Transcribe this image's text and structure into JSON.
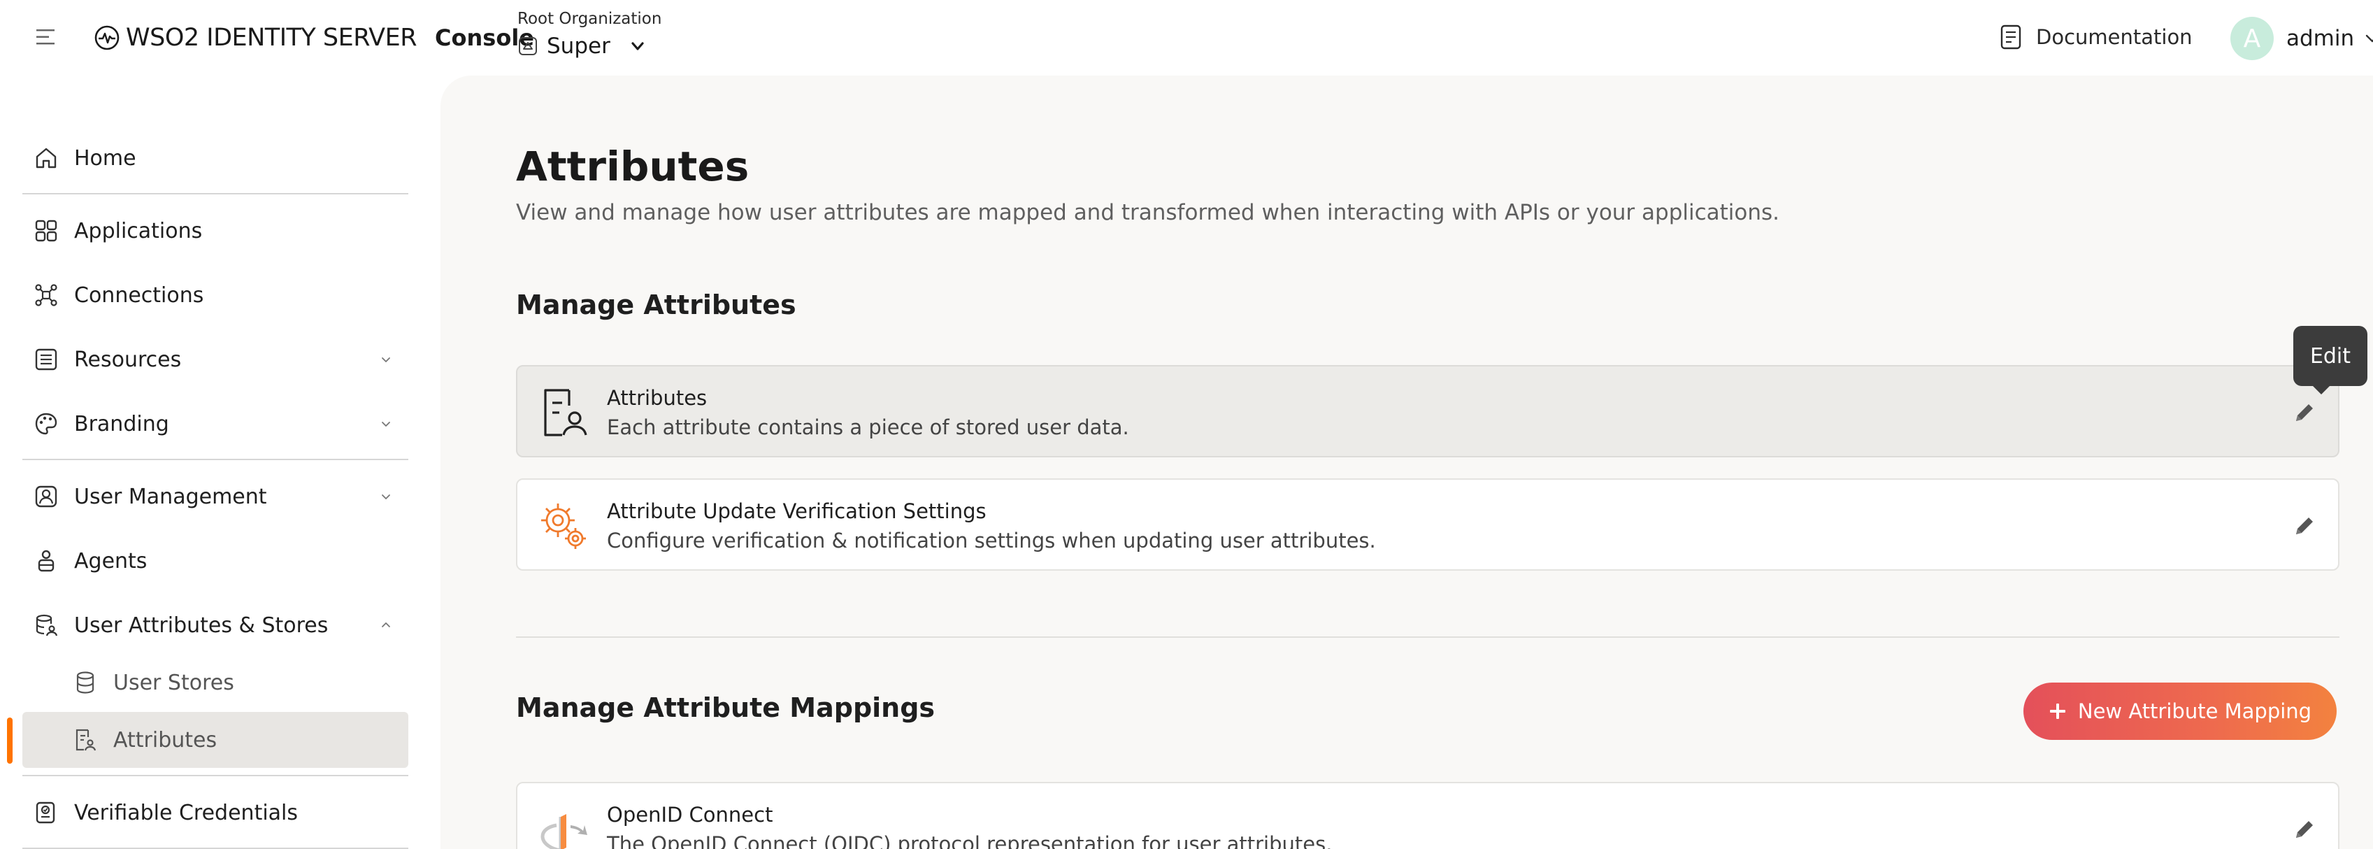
{
  "header": {
    "brand_name": "WSO2 IDENTITY SERVER",
    "console_label": "Console",
    "org_label": "Root Organization",
    "org_name": "Super",
    "documentation_label": "Documentation",
    "user_initial": "A",
    "user_name": "admin"
  },
  "sidebar": {
    "items": [
      {
        "label": "Home",
        "icon": "home-icon"
      },
      {
        "label": "Applications",
        "icon": "applications-icon"
      },
      {
        "label": "Connections",
        "icon": "connections-icon"
      },
      {
        "label": "Resources",
        "icon": "resources-icon"
      },
      {
        "label": "Branding",
        "icon": "branding-icon"
      },
      {
        "label": "User Management",
        "icon": "user-management-icon"
      },
      {
        "label": "Agents",
        "icon": "agents-icon"
      },
      {
        "label": "User Attributes & Stores",
        "icon": "user-attributes-icon"
      },
      {
        "label": "Verifiable Credentials",
        "icon": "verifiable-credentials-icon"
      }
    ],
    "sub_items": [
      {
        "label": "User Stores",
        "icon": "database-icon"
      },
      {
        "label": "Attributes",
        "icon": "attributes-icon",
        "active": true
      }
    ]
  },
  "main": {
    "title": "Attributes",
    "description": "View and manage how user attributes are mapped and transformed when interacting with APIs or your applications.",
    "manage_attributes_title": "Manage Attributes",
    "cards": [
      {
        "title": "Attributes",
        "description": "Each attribute contains a piece of stored user data."
      },
      {
        "title": "Attribute Update Verification Settings",
        "description": "Configure verification & notification settings when updating user attributes."
      }
    ],
    "manage_mappings_title": "Manage Attribute Mappings",
    "new_mapping_label": "New Attribute Mapping",
    "mapping_cards": [
      {
        "title": "OpenID Connect",
        "description": "The OpenID Connect (OIDC) protocol representation for user attributes."
      }
    ],
    "tooltip_text": "Edit"
  },
  "colors": {
    "accent_orange": "#ff7300",
    "button_gradient_start": "#e4505a",
    "button_gradient_end": "#f3823f",
    "main_background": "#f9f8f6",
    "avatar_background": "#c8ecdc"
  }
}
